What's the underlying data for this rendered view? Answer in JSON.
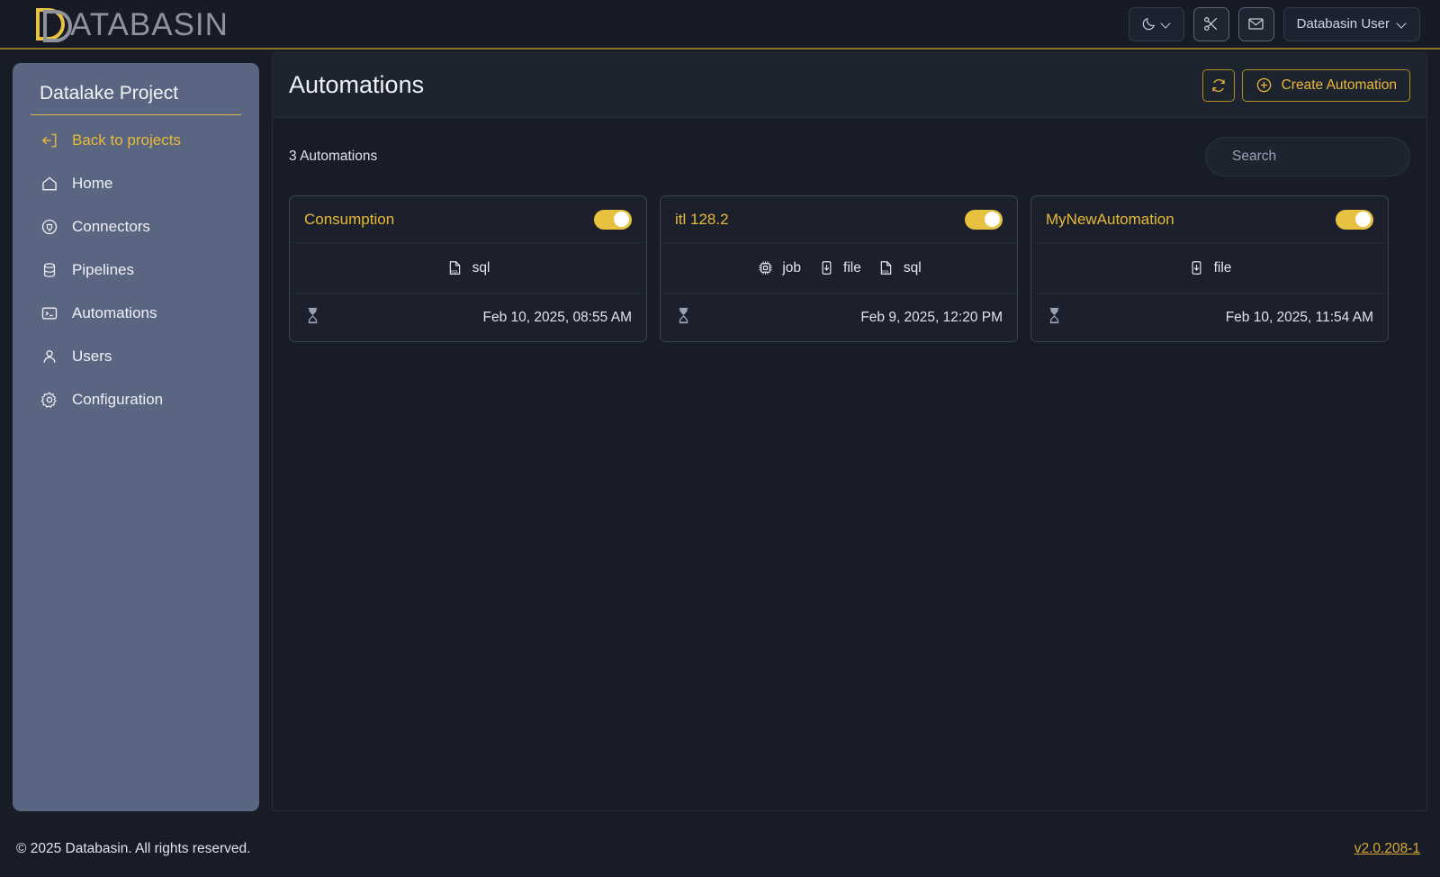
{
  "app": {
    "logo_text": "DATABASIN",
    "logo_accent_hex": "#e8c140",
    "accent_hex": "#e8b938"
  },
  "topbar": {
    "theme_toggle": {
      "icon": "moon-icon",
      "chevron": "chevron-down-icon"
    },
    "tools_button": {
      "icon": "scissors-icon"
    },
    "mail_button": {
      "icon": "envelope-icon"
    },
    "user_menu": {
      "label": "Databasin User",
      "chevron": "chevron-down-icon"
    }
  },
  "sidebar": {
    "project_title": "Datalake Project",
    "items": [
      {
        "label": "Back to projects",
        "icon": "logout-arrow-icon",
        "accent": true
      },
      {
        "label": "Home",
        "icon": "home-icon",
        "accent": false
      },
      {
        "label": "Connectors",
        "icon": "plug-circle-icon",
        "accent": false
      },
      {
        "label": "Pipelines",
        "icon": "database-icon",
        "accent": false
      },
      {
        "label": "Automations",
        "icon": "terminal-icon",
        "accent": false
      },
      {
        "label": "Users",
        "icon": "user-icon",
        "accent": false
      },
      {
        "label": "Configuration",
        "icon": "gear-icon",
        "accent": false
      }
    ]
  },
  "main": {
    "page_title": "Automations",
    "refresh_button": {
      "icon": "refresh-icon"
    },
    "create_button": {
      "label": "Create Automation",
      "icon": "plus-circle-icon"
    },
    "count_label": "3 Automations",
    "search": {
      "placeholder": "Search",
      "value": "",
      "icon": "search-icon"
    },
    "cards": [
      {
        "title": "Consumption",
        "enabled": true,
        "tags": [
          {
            "label": "sql",
            "icon": "sql-file-icon"
          }
        ],
        "date": "Feb 10, 2025, 08:55 AM",
        "date_icon": "hourglass-icon"
      },
      {
        "title": "itl 128.2",
        "enabled": true,
        "tags": [
          {
            "label": "job",
            "icon": "chip-icon"
          },
          {
            "label": "file",
            "icon": "download-box-icon"
          },
          {
            "label": "sql",
            "icon": "sql-file-icon"
          }
        ],
        "date": "Feb 9, 2025, 12:20 PM",
        "date_icon": "hourglass-icon"
      },
      {
        "title": "MyNewAutomation",
        "enabled": true,
        "tags": [
          {
            "label": "file",
            "icon": "download-box-icon"
          }
        ],
        "date": "Feb 10, 2025, 11:54 AM",
        "date_icon": "hourglass-icon"
      }
    ]
  },
  "footer": {
    "copyright": "© 2025 Databasin. All rights reserved.",
    "version": "v2.0.208-1"
  }
}
